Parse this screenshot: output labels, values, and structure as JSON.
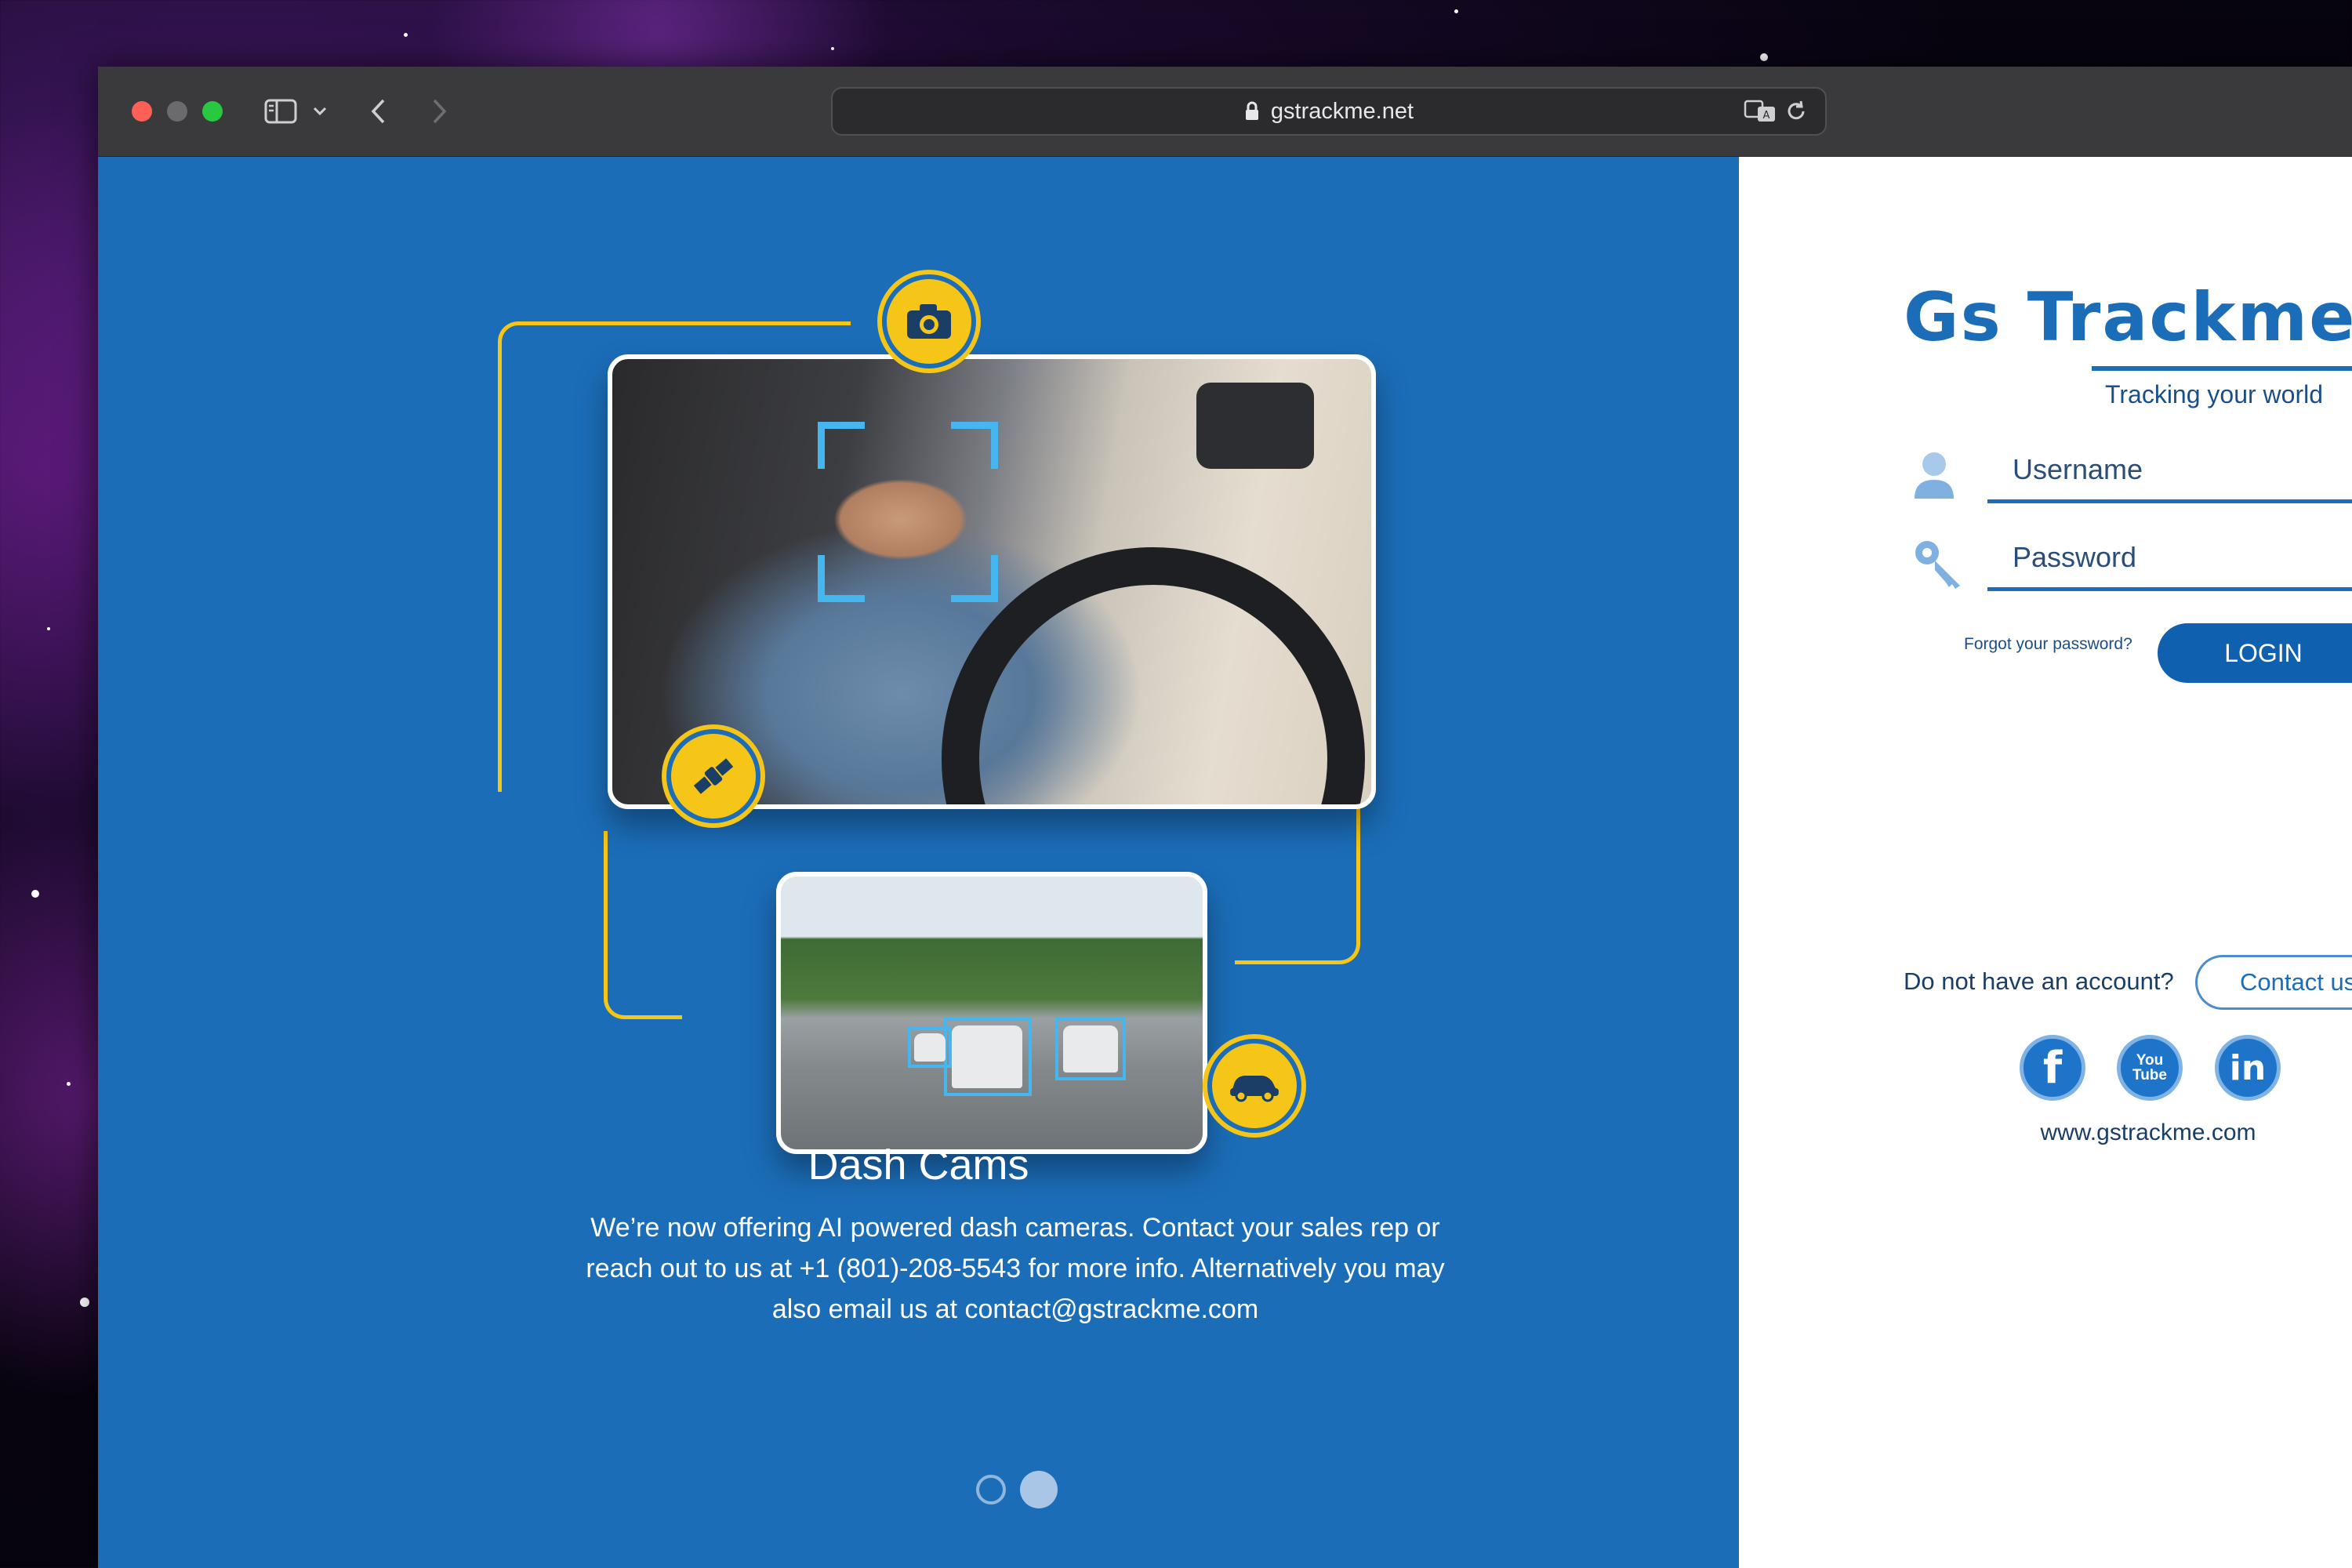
{
  "browser": {
    "url": "gstrackme.net"
  },
  "promo": {
    "title": "Dash Cams",
    "description": "We’re now offering AI powered dash cameras. Contact your sales rep or reach out to us at +1 (801)-208-5543 for more info. Alternatively you may also email us at contact@gstrackme.com",
    "slides": 2,
    "active_slide": 2,
    "accent_color": "#f5c518",
    "background_color": "#1b6db8"
  },
  "login": {
    "logo_text": "Gs Trackme",
    "tagline": "Tracking your world",
    "username_placeholder": "Username",
    "password_placeholder": "Password",
    "forgot_label": "Forgot your password?",
    "login_label": "LOGIN",
    "no_account_text": "Do not have an account?",
    "contact_label": "Contact us",
    "website": "www.gstrackme.com",
    "brand_color": "#1b6db8"
  },
  "social": {
    "facebook_label": "f",
    "youtube_label_top": "You",
    "youtube_label_bottom": "Tube",
    "linkedin_label": "in"
  }
}
